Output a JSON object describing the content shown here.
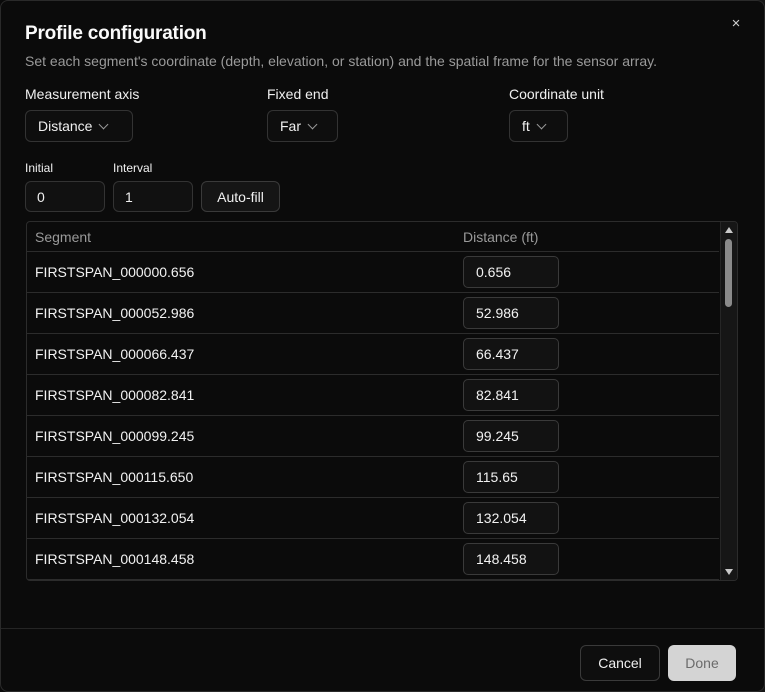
{
  "dialog": {
    "title": "Profile configuration",
    "subtitle": "Set each segment's coordinate (depth, elevation, or station) and the spatial frame for the sensor array.",
    "close_icon": "×"
  },
  "fields": {
    "measurement_axis": {
      "label": "Measurement axis",
      "value": "Distance"
    },
    "fixed_end": {
      "label": "Fixed end",
      "value": "Far"
    },
    "coordinate_unit": {
      "label": "Coordinate unit",
      "value": "ft"
    }
  },
  "autofill": {
    "initial_label": "Initial",
    "initial_value": "0",
    "interval_label": "Interval",
    "interval_value": "1",
    "button_label": "Auto-fill"
  },
  "table": {
    "headers": {
      "segment": "Segment",
      "distance": "Distance (ft)"
    },
    "rows": [
      {
        "segment": "FIRSTSPAN_000000.656",
        "distance": "0.656"
      },
      {
        "segment": "FIRSTSPAN_000052.986",
        "distance": "52.986"
      },
      {
        "segment": "FIRSTSPAN_000066.437",
        "distance": "66.437"
      },
      {
        "segment": "FIRSTSPAN_000082.841",
        "distance": "82.841"
      },
      {
        "segment": "FIRSTSPAN_000099.245",
        "distance": "99.245"
      },
      {
        "segment": "FIRSTSPAN_000115.650",
        "distance": "115.65"
      },
      {
        "segment": "FIRSTSPAN_000132.054",
        "distance": "132.054"
      },
      {
        "segment": "FIRSTSPAN_000148.458",
        "distance": "148.458"
      }
    ]
  },
  "footer": {
    "cancel_label": "Cancel",
    "done_label": "Done"
  },
  "colors": {
    "background": "#0b0b0b",
    "done_button": "#d4d4d4",
    "border": "#2c2c2c"
  }
}
